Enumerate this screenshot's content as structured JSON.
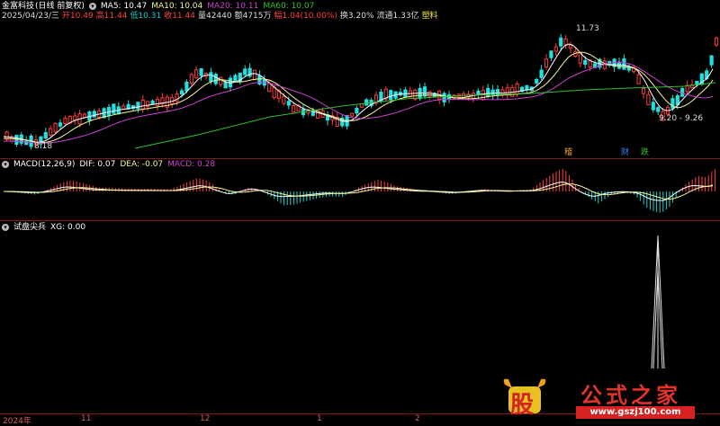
{
  "main_chart": {
    "stock_name": "金富科技",
    "period_label": "(日线 前复权)",
    "ma": [
      {
        "label": "MA5: 10.47",
        "color": "#ffffff"
      },
      {
        "label": "MA10: 10.04",
        "color": "#f5f59a"
      },
      {
        "label": "MA20: 10.11",
        "color": "#d040d0"
      },
      {
        "label": "MA60: 10.07",
        "color": "#30c030"
      }
    ],
    "info": [
      {
        "text": "2025/04/23/三",
        "color": "#dddddd"
      },
      {
        "text": "开10.49",
        "color": "#ff4040"
      },
      {
        "text": "高11.44",
        "color": "#ff4040"
      },
      {
        "text": "低10.31",
        "color": "#00d0d0"
      },
      {
        "text": "收11.44",
        "color": "#ff4040"
      },
      {
        "text": "量42440",
        "color": "#dddddd"
      },
      {
        "text": "额4715万",
        "color": "#dddddd"
      },
      {
        "text": "幅1.04(10.00%)",
        "color": "#ff4040"
      },
      {
        "text": "换3.20%",
        "color": "#dddddd"
      },
      {
        "text": "流通1.33亿",
        "color": "#dddddd"
      },
      {
        "text": "塑料",
        "color": "#f0e040"
      }
    ],
    "annotation_high": "11.73",
    "annotation_low": "8.18",
    "annotation_range": "9.20 - 9.26",
    "events": [
      {
        "text": "稽",
        "color": "#f0a040"
      },
      {
        "text": "财",
        "color": "#4080ff"
      },
      {
        "text": "跌",
        "color": "#30c030"
      }
    ]
  },
  "macd_panel": {
    "title": "MACD(12,26,9)",
    "dif": "DIF: 0.07",
    "dea": "DEA: -0.07",
    "macd": "MACD: 0.28",
    "macd_color": "#d040d0"
  },
  "xg_panel": {
    "title": "试盘尖兵",
    "xg": "XG: 0.00"
  },
  "time_axis": [
    "2024年",
    "11",
    "12",
    "1",
    "2"
  ],
  "watermark": {
    "logo_char": "股",
    "site_name": "公式之家",
    "url": "www.gszj100.com"
  }
}
